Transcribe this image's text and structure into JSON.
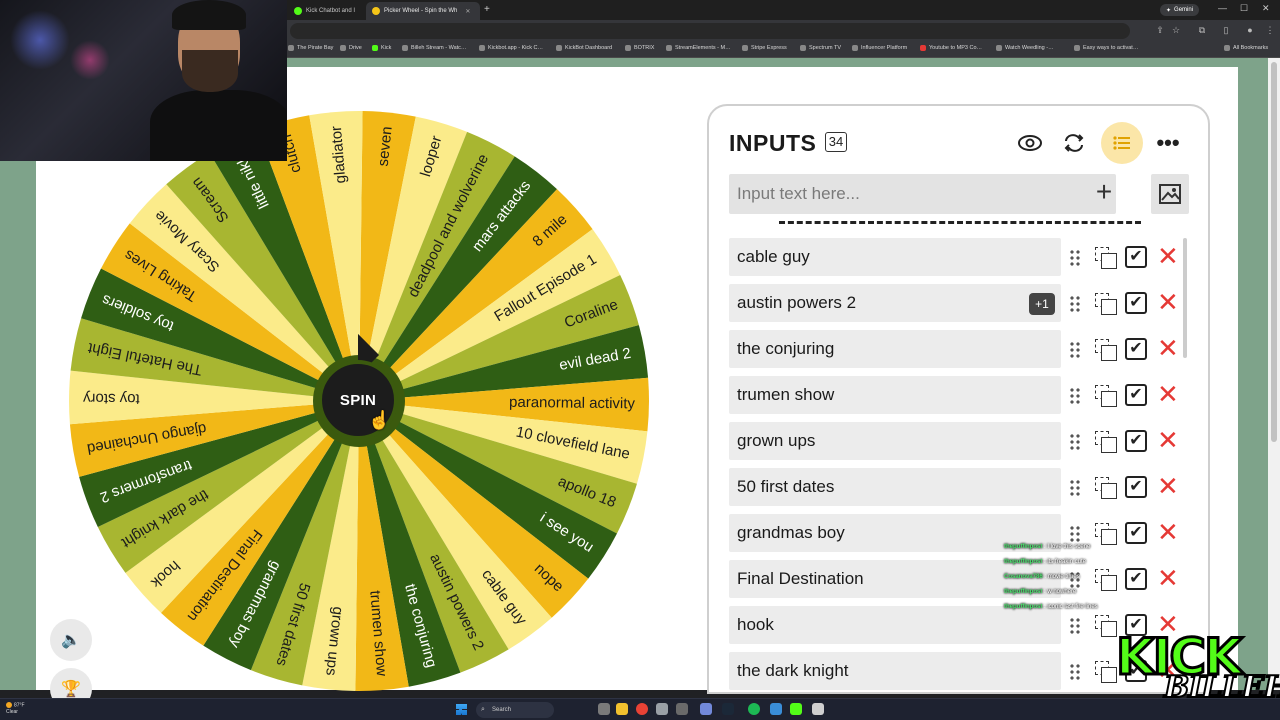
{
  "browser": {
    "tabs": [
      {
        "label": "Kick Chatbot and I",
        "active": false
      },
      {
        "label": "Picker Wheel - Spin the Wh",
        "active": true
      }
    ],
    "gemini_label": "Gemini",
    "bookmarks": [
      "The Pirate Bay",
      "Drive",
      "Kick",
      "Billeh Stream - Watc…",
      "Kickbot.app - Kick C…",
      "KickBot Dashboard",
      "BOTRIX",
      "StreamElements - M…",
      "Stripe Express",
      "Spectrum TV",
      "Influencer Platform",
      "Youtube to MP3 Co…",
      "Watch Weedling -…",
      "Easy ways to activat…",
      "All Bookmarks"
    ]
  },
  "wheel": {
    "spin_label": "SPIN",
    "palette": [
      "#f2b817",
      "#fbeb8a",
      "#a8b631",
      "#2f5e14"
    ],
    "segments": [
      "seven",
      "looper",
      "deadpool and wolverine",
      "mars attacks",
      "8 mile",
      "Fallout Episode 1",
      "Coraline",
      "evil dead 2",
      "paranormal activity",
      "10 clovefield lane",
      "apollo 18",
      "i see you",
      "nope",
      "cable guy",
      "austin powers 2",
      "the conjuring",
      "trumen show",
      "grown ups",
      "50 first dates",
      "grandmas boy",
      "Final Destination",
      "hook",
      "the dark knight",
      "transformers 2",
      "django Unchained",
      "toy story",
      "The Hateful Eight",
      "toy soldiers",
      "Taking Lives",
      "Scary Movie",
      "Scream",
      "little nikki",
      "clutch",
      "gladiator"
    ]
  },
  "panel": {
    "title": "INPUTS",
    "count": "34",
    "input_placeholder": "Input text here...",
    "entries": [
      {
        "text": "cable guy",
        "badge": ""
      },
      {
        "text": "austin powers 2",
        "badge": "+1"
      },
      {
        "text": "the conjuring",
        "badge": ""
      },
      {
        "text": "trumen show",
        "badge": ""
      },
      {
        "text": "grown ups",
        "badge": ""
      },
      {
        "text": "50 first dates",
        "badge": ""
      },
      {
        "text": "grandmas boy",
        "badge": ""
      },
      {
        "text": "Final Destination",
        "badge": ""
      },
      {
        "text": "hook",
        "badge": ""
      },
      {
        "text": "the dark knight",
        "badge": ""
      }
    ]
  },
  "chat": [
    {
      "user": "thepuffinpost",
      "msg": "I love this scene"
    },
    {
      "user": "thepuffinpost",
      "msg": "its freakin cute"
    },
    {
      "user": "Cosanova786",
      "msg": "movie times"
    },
    {
      "user": "thepuffinpost",
      "msg": "w nowhere"
    },
    {
      "user": "thepuffinpost",
      "msg": "iconic last fire lines"
    }
  ],
  "overlay": {
    "kick_text": "KICK",
    "channel_text": "BILLEH"
  },
  "taskbar": {
    "weather_temp": "87°F",
    "weather_desc": "Clear",
    "search_label": "Search"
  }
}
